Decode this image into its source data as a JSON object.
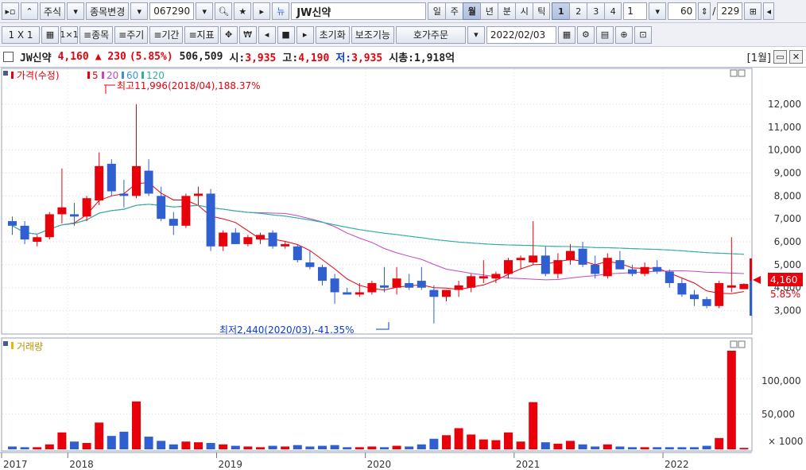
{
  "toolbar1": {
    "market_type": "주식",
    "change_stock": "종목변경",
    "code": "067290",
    "stock_name": "JW신약",
    "periods": [
      "일",
      "주",
      "월",
      "년",
      "분",
      "시",
      "틱"
    ],
    "active_period": "월",
    "interval_buttons": [
      "1",
      "2",
      "3",
      "4"
    ],
    "interval_value": "1",
    "count_value": "60",
    "total_count": "229",
    "slash": "/"
  },
  "toolbar2": {
    "layout_label": "1 X 1",
    "buttons": [
      "종목",
      "주기",
      "기간",
      "지표"
    ],
    "reset_label": "초기화",
    "aux_label": "보조기능",
    "order_label": "호가주문",
    "date_value": "2022/02/03"
  },
  "infobar": {
    "name": "JW신약",
    "price": "4,160",
    "change": "▲ 230",
    "change_pct": "(5.85%)",
    "volume": "506,509",
    "open_label": "시:",
    "open": "3,935",
    "high_label": "고:",
    "high": "4,190",
    "low_label": "저:",
    "low": "3,935",
    "mcap_label": "시총:",
    "mcap": "1,918억",
    "period_tag": "[1월]"
  },
  "price_panel": {
    "title": "가격(수정)",
    "ma_labels": [
      "5",
      "20",
      "60",
      "120"
    ],
    "ma_colors": [
      "#e8000b",
      "#c048c0",
      "#3c8ee0",
      "#2fb39a"
    ],
    "high_annotation": "최고11,996(2018/04),188.37%",
    "low_annotation": "최저2,440(2020/03),-41.35%",
    "current_price": "4,160",
    "current_pct": "5.85%"
  },
  "volume_panel": {
    "title": "거래량",
    "y_ticks": [
      "100,000",
      "50,000"
    ],
    "unit": "× 1000"
  },
  "chart_data": {
    "type": "candlestick",
    "x_axis_labels": [
      "2017",
      "2018",
      "2019",
      "2020",
      "2021",
      "2022"
    ],
    "y_ticks": [
      3000,
      4000,
      5000,
      6000,
      7000,
      8000,
      9000,
      10000,
      11000,
      12000
    ],
    "ylim": [
      2500,
      12900
    ],
    "volume_ylim": [
      0,
      140000
    ],
    "candles": [
      {
        "o": 6900,
        "h": 7100,
        "l": 6300,
        "c": 6700,
        "v": 4000
      },
      {
        "o": 6700,
        "h": 6900,
        "l": 5900,
        "c": 6100,
        "v": 3000
      },
      {
        "o": 6000,
        "h": 6300,
        "l": 5800,
        "c": 6200,
        "v": 3000
      },
      {
        "o": 6200,
        "h": 7300,
        "l": 6100,
        "c": 7200,
        "v": 7000
      },
      {
        "o": 7200,
        "h": 9200,
        "l": 6800,
        "c": 7500,
        "v": 24000
      },
      {
        "o": 7200,
        "h": 7700,
        "l": 6700,
        "c": 7100,
        "v": 11000
      },
      {
        "o": 7100,
        "h": 8000,
        "l": 6900,
        "c": 7900,
        "v": 9000
      },
      {
        "o": 7800,
        "h": 9900,
        "l": 7600,
        "c": 9300,
        "v": 38000
      },
      {
        "o": 9400,
        "h": 9600,
        "l": 8000,
        "c": 8200,
        "v": 19000
      },
      {
        "o": 8100,
        "h": 8700,
        "l": 7500,
        "c": 8000,
        "v": 25000
      },
      {
        "o": 8000,
        "h": 11996,
        "l": 7900,
        "c": 9300,
        "v": 68000
      },
      {
        "o": 9100,
        "h": 9600,
        "l": 8000,
        "c": 8100,
        "v": 18000
      },
      {
        "o": 8000,
        "h": 8400,
        "l": 6900,
        "c": 7000,
        "v": 12000
      },
      {
        "o": 7000,
        "h": 7300,
        "l": 6300,
        "c": 6700,
        "v": 7000
      },
      {
        "o": 6700,
        "h": 8100,
        "l": 6600,
        "c": 8000,
        "v": 11000
      },
      {
        "o": 8000,
        "h": 8400,
        "l": 7600,
        "c": 8100,
        "v": 10000
      },
      {
        "o": 8100,
        "h": 8300,
        "l": 5600,
        "c": 5800,
        "v": 9000
      },
      {
        "o": 5800,
        "h": 6500,
        "l": 5600,
        "c": 6400,
        "v": 7000
      },
      {
        "o": 6400,
        "h": 6600,
        "l": 5900,
        "c": 5900,
        "v": 5000
      },
      {
        "o": 5900,
        "h": 6300,
        "l": 5800,
        "c": 6200,
        "v": 4000
      },
      {
        "o": 6100,
        "h": 6400,
        "l": 5900,
        "c": 6300,
        "v": 3000
      },
      {
        "o": 6400,
        "h": 6500,
        "l": 5700,
        "c": 5800,
        "v": 5000
      },
      {
        "o": 5800,
        "h": 6000,
        "l": 5700,
        "c": 5900,
        "v": 4000
      },
      {
        "o": 5800,
        "h": 5900,
        "l": 5100,
        "c": 5200,
        "v": 6000
      },
      {
        "o": 5100,
        "h": 5600,
        "l": 4800,
        "c": 4900,
        "v": 4000
      },
      {
        "o": 4900,
        "h": 5000,
        "l": 4100,
        "c": 4300,
        "v": 5000
      },
      {
        "o": 4400,
        "h": 4600,
        "l": 3300,
        "c": 3800,
        "v": 6000
      },
      {
        "o": 3800,
        "h": 4000,
        "l": 3700,
        "c": 3700,
        "v": 3000
      },
      {
        "o": 3700,
        "h": 4200,
        "l": 3600,
        "c": 3800,
        "v": 3000
      },
      {
        "o": 3800,
        "h": 4300,
        "l": 3700,
        "c": 4200,
        "v": 4000
      },
      {
        "o": 4100,
        "h": 4900,
        "l": 3800,
        "c": 4000,
        "v": 3000
      },
      {
        "o": 4000,
        "h": 4900,
        "l": 3700,
        "c": 4400,
        "v": 5000
      },
      {
        "o": 4200,
        "h": 4600,
        "l": 3900,
        "c": 4000,
        "v": 4000
      },
      {
        "o": 4300,
        "h": 4900,
        "l": 3900,
        "c": 4000,
        "v": 7000
      },
      {
        "o": 3900,
        "h": 4100,
        "l": 2440,
        "c": 3600,
        "v": 15000
      },
      {
        "o": 3600,
        "h": 3900,
        "l": 3400,
        "c": 3900,
        "v": 20000
      },
      {
        "o": 3900,
        "h": 4300,
        "l": 3600,
        "c": 4100,
        "v": 30000
      },
      {
        "o": 4000,
        "h": 4600,
        "l": 3800,
        "c": 4500,
        "v": 21000
      },
      {
        "o": 4400,
        "h": 5200,
        "l": 4200,
        "c": 4500,
        "v": 14000
      },
      {
        "o": 4400,
        "h": 4700,
        "l": 4200,
        "c": 4600,
        "v": 13000
      },
      {
        "o": 4600,
        "h": 5300,
        "l": 4400,
        "c": 5200,
        "v": 24000
      },
      {
        "o": 5200,
        "h": 5400,
        "l": 4800,
        "c": 5300,
        "v": 11000
      },
      {
        "o": 5100,
        "h": 6900,
        "l": 5000,
        "c": 5400,
        "v": 67000
      },
      {
        "o": 5400,
        "h": 5800,
        "l": 4500,
        "c": 4600,
        "v": 10000
      },
      {
        "o": 4600,
        "h": 5500,
        "l": 4400,
        "c": 5200,
        "v": 8000
      },
      {
        "o": 5200,
        "h": 5900,
        "l": 5000,
        "c": 5600,
        "v": 12000
      },
      {
        "o": 5700,
        "h": 6000,
        "l": 4900,
        "c": 5000,
        "v": 7000
      },
      {
        "o": 5000,
        "h": 5400,
        "l": 4400,
        "c": 4600,
        "v": 4000
      },
      {
        "o": 4500,
        "h": 5500,
        "l": 4400,
        "c": 5300,
        "v": 7000
      },
      {
        "o": 5200,
        "h": 5600,
        "l": 4800,
        "c": 4800,
        "v": 4000
      },
      {
        "o": 4800,
        "h": 5000,
        "l": 4500,
        "c": 4600,
        "v": 3000
      },
      {
        "o": 4600,
        "h": 5100,
        "l": 4500,
        "c": 4900,
        "v": 3000
      },
      {
        "o": 4900,
        "h": 5200,
        "l": 4600,
        "c": 4700,
        "v": 3000
      },
      {
        "o": 4700,
        "h": 4800,
        "l": 4000,
        "c": 4200,
        "v": 3000
      },
      {
        "o": 4200,
        "h": 4400,
        "l": 3600,
        "c": 3700,
        "v": 3000
      },
      {
        "o": 3700,
        "h": 3900,
        "l": 3200,
        "c": 3500,
        "v": 3000
      },
      {
        "o": 3500,
        "h": 3600,
        "l": 3100,
        "c": 3200,
        "v": 5000
      },
      {
        "o": 3200,
        "h": 4300,
        "l": 3100,
        "c": 4200,
        "v": 16000
      },
      {
        "o": 4000,
        "h": 6200,
        "l": 3800,
        "c": 4100,
        "v": 140000
      },
      {
        "o": 3935,
        "h": 4190,
        "l": 3935,
        "c": 4160,
        "v": 2000
      }
    ]
  }
}
